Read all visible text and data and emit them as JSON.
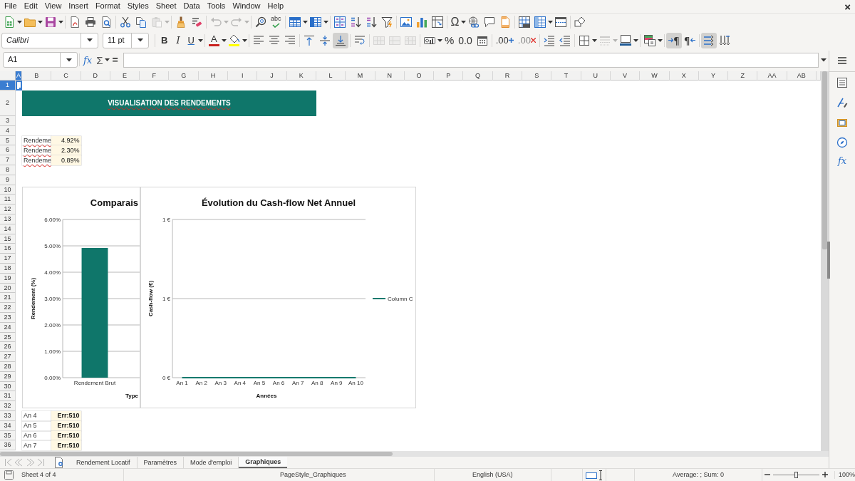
{
  "menu_bar": {
    "items": [
      "File",
      "Edit",
      "View",
      "Insert",
      "Format",
      "Styles",
      "Sheet",
      "Data",
      "Tools",
      "Window",
      "Help"
    ],
    "close_glyph": "×"
  },
  "standard_toolbar": {
    "paste": {
      "disabled": true
    },
    "undo": {
      "disabled": true
    },
    "redo": {
      "disabled": true
    },
    "spelling": {
      "label": "abc"
    },
    "special_character": {
      "glyph": "Ω"
    }
  },
  "format_toolbar": {
    "font_name": "Calibri",
    "font_size": "11 pt",
    "bold": "B",
    "italic": "I",
    "underline": "U",
    "font_color": {
      "glyph": "A",
      "color": "#c9211e"
    },
    "highlight_color": {
      "color": "#ffff00"
    },
    "vertical_alignment": {
      "top": false,
      "center": false,
      "bottom": true
    },
    "merge_and_center": {
      "disabled": true
    },
    "merge_cells": {
      "disabled": true
    },
    "unmerge_cells": {
      "disabled": true
    },
    "percent": "%",
    "standard_format": "0.0",
    "add_decimal": ".00",
    "delete_decimal": ".00",
    "border_style": {
      "disabled": true
    },
    "border_color": {
      "color": "#1e5a96"
    },
    "paragraph_direction": {
      "left_to_right": {
        "glyph": "¶",
        "selected": true
      },
      "right_to_left": {
        "glyph": "¶",
        "selected": false
      }
    },
    "text_direction": {
      "horizontal": true,
      "vertical": false
    }
  },
  "formula_bar": {
    "name_box": "A1",
    "function_wizard": "fx",
    "sum": "Σ",
    "formula": "="
  },
  "sheet": {
    "columns": [
      {
        "label": "A",
        "selected": true
      },
      {
        "label": "B",
        "selected": false
      },
      {
        "label": "C",
        "selected": false
      },
      {
        "label": "D",
        "selected": false
      },
      {
        "label": "E",
        "selected": false
      },
      {
        "label": "F",
        "selected": false
      },
      {
        "label": "G",
        "selected": false
      },
      {
        "label": "H",
        "selected": false
      },
      {
        "label": "I",
        "selected": false
      },
      {
        "label": "J",
        "selected": false
      },
      {
        "label": "K",
        "selected": false
      },
      {
        "label": "L",
        "selected": false
      },
      {
        "label": "M",
        "selected": false
      },
      {
        "label": "N",
        "selected": false
      },
      {
        "label": "O",
        "selected": false
      },
      {
        "label": "P",
        "selected": false
      },
      {
        "label": "Q",
        "selected": false
      },
      {
        "label": "R",
        "selected": false
      },
      {
        "label": "S",
        "selected": false
      },
      {
        "label": "T",
        "selected": false
      },
      {
        "label": "U",
        "selected": false
      },
      {
        "label": "V",
        "selected": false
      },
      {
        "label": "W",
        "selected": false
      },
      {
        "label": "X",
        "selected": false
      },
      {
        "label": "Y",
        "selected": false
      },
      {
        "label": "Z",
        "selected": false
      },
      {
        "label": "AA",
        "selected": false
      },
      {
        "label": "AB",
        "selected": false
      }
    ],
    "rows": [
      {
        "header": "1",
        "selected": true
      },
      {
        "header": "2",
        "selected": false,
        "cells": {
          "B": {
            "text": "VISUALISATION DES RENDEMENTS",
            "kind": "banner",
            "misspelled": true,
            "overflow": false
          }
        }
      },
      {
        "header": "3",
        "selected": false
      },
      {
        "header": "4",
        "selected": false
      },
      {
        "header": "5",
        "selected": false,
        "cells": {
          "B": {
            "text": "Rendeme",
            "kind": "label",
            "misspelled": true,
            "overflow": true
          },
          "C": {
            "text": "4.92%",
            "kind": "value",
            "misspelled": false,
            "overflow": false
          }
        }
      },
      {
        "header": "6",
        "selected": false,
        "cells": {
          "B": {
            "text": "Rendeme",
            "kind": "label",
            "misspelled": true,
            "overflow": true
          },
          "C": {
            "text": "2.30%",
            "kind": "value",
            "misspelled": false,
            "overflow": false
          }
        }
      },
      {
        "header": "7",
        "selected": false,
        "cells": {
          "B": {
            "text": "Rendeme",
            "kind": "label",
            "misspelled": true,
            "overflow": true
          },
          "C": {
            "text": "0.89%",
            "kind": "value",
            "misspelled": false,
            "overflow": false
          }
        }
      },
      {
        "header": "8",
        "selected": false
      },
      {
        "header": "9",
        "selected": false
      },
      {
        "header": "10",
        "selected": false
      },
      {
        "header": "11",
        "selected": false
      },
      {
        "header": "12",
        "selected": false
      },
      {
        "header": "13",
        "selected": false
      },
      {
        "header": "14",
        "selected": false
      },
      {
        "header": "15",
        "selected": false
      },
      {
        "header": "16",
        "selected": false
      },
      {
        "header": "17",
        "selected": false
      },
      {
        "header": "18",
        "selected": false
      },
      {
        "header": "19",
        "selected": false
      },
      {
        "header": "20",
        "selected": false
      },
      {
        "header": "21",
        "selected": false
      },
      {
        "header": "22",
        "selected": false
      },
      {
        "header": "23",
        "selected": false
      },
      {
        "header": "24",
        "selected": false
      },
      {
        "header": "25",
        "selected": false
      },
      {
        "header": "26",
        "selected": false
      },
      {
        "header": "27",
        "selected": false
      },
      {
        "header": "28",
        "selected": false
      },
      {
        "header": "29",
        "selected": false
      },
      {
        "header": "30",
        "selected": false
      },
      {
        "header": "31",
        "selected": false
      },
      {
        "header": "32",
        "selected": false
      },
      {
        "header": "33",
        "selected": false,
        "cells": {
          "B": {
            "text": "An 4",
            "kind": "label",
            "misspelled": false,
            "overflow": false
          },
          "C": {
            "text": "Err:510",
            "kind": "error",
            "misspelled": false,
            "overflow": false
          }
        }
      },
      {
        "header": "34",
        "selected": false,
        "cells": {
          "B": {
            "text": "An 5",
            "kind": "label",
            "misspelled": false,
            "overflow": false
          },
          "C": {
            "text": "Err:510",
            "kind": "error",
            "misspelled": false,
            "overflow": false
          }
        }
      },
      {
        "header": "35",
        "selected": false,
        "cells": {
          "B": {
            "text": "An 6",
            "kind": "label",
            "misspelled": false,
            "overflow": false
          },
          "C": {
            "text": "Err:510",
            "kind": "error",
            "misspelled": false,
            "overflow": false
          }
        }
      },
      {
        "header": "36",
        "selected": false,
        "cells": {
          "B": {
            "text": "An 7",
            "kind": "label",
            "misspelled": false,
            "overflow": false
          },
          "C": {
            "text": "Err:510",
            "kind": "error",
            "misspelled": false,
            "overflow": false
          }
        }
      }
    ]
  },
  "charts": [
    {
      "chart_data": {
        "type": "bar",
        "title": "Comparais",
        "xlabel": "Type",
        "ylabel": "Rendement (%)",
        "categories": [
          "Rendement Brut"
        ],
        "values": [
          4.92
        ],
        "ylim": [
          0,
          6
        ],
        "grid": true,
        "yticks": [
          {
            "value": 0,
            "label": "0.00%"
          },
          {
            "value": 1,
            "label": "1.00%"
          },
          {
            "value": 2,
            "label": "2.00%"
          },
          {
            "value": 3,
            "label": "3.00%"
          },
          {
            "value": 4,
            "label": "4.00%"
          },
          {
            "value": 5,
            "label": "5.00%"
          },
          {
            "value": 6,
            "label": "6.00%"
          }
        ]
      }
    },
    {
      "chart_data": {
        "type": "line",
        "title": "Évolution du Cash-flow Net Annuel",
        "xlabel": "Années",
        "ylabel": "Cash-flow (€)",
        "categories": [
          "An 1",
          "An 2",
          "An 3",
          "An 4",
          "An 5",
          "An 6",
          "An 7",
          "An 8",
          "An 9",
          "An 10"
        ],
        "series": [
          {
            "name": "Column C",
            "color": "#127a6e",
            "values": [
              0,
              0,
              0,
              0,
              0,
              0,
              0,
              0,
              0,
              0
            ]
          }
        ],
        "ylim": [
          0,
          1
        ],
        "grid": true,
        "yticks": [
          {
            "value": 0,
            "label": "0 €"
          },
          {
            "value": 0.5,
            "label": "1 €"
          },
          {
            "value": 1,
            "label": "1 €"
          }
        ]
      }
    }
  ],
  "sheet_tabs": {
    "navigation_disabled": true,
    "tabs": [
      {
        "label": "Rendement Locatif",
        "selected": false
      },
      {
        "label": "Paramètres",
        "selected": false
      },
      {
        "label": "Mode d'emploi",
        "selected": false
      },
      {
        "label": "Graphiques",
        "selected": true
      }
    ]
  },
  "sidebar": {
    "functions": "fx"
  },
  "status_bar": {
    "sheet": "Sheet 4 of 4",
    "page_style": "PageStyle_Graphiques",
    "language": "English (USA)",
    "selection_summary": "Average: ; Sum: 0",
    "zoom": {
      "level": 0.5,
      "reading": "100%"
    }
  }
}
